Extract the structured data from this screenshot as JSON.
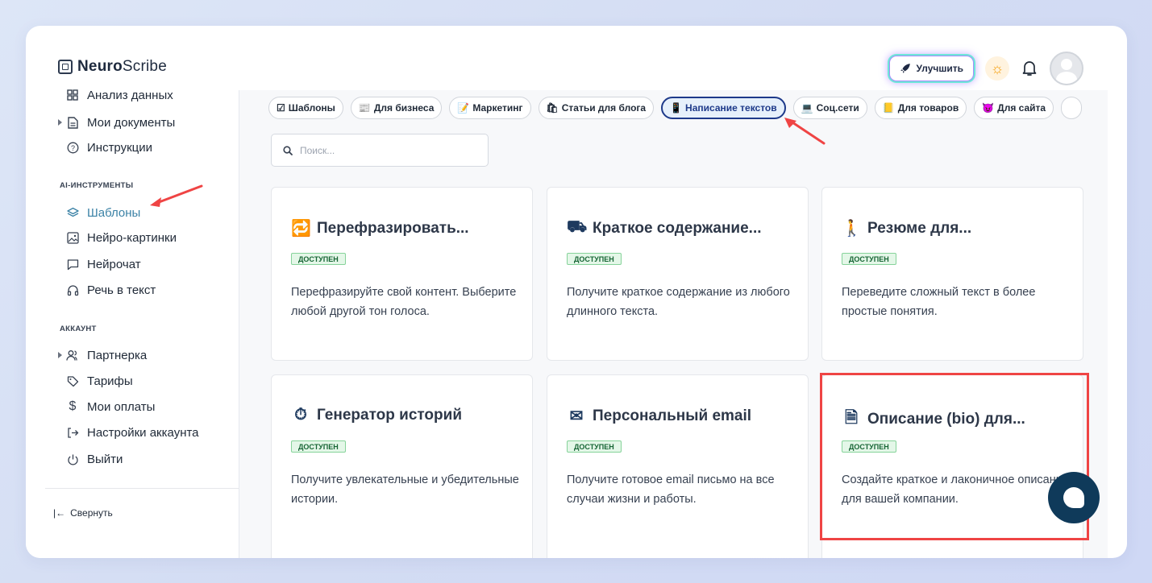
{
  "app": {
    "logo_bold": "Neuro",
    "logo_rest": "Scribe"
  },
  "header": {
    "upgrade_label": "Улучшить",
    "theme_icon": "sun-icon",
    "notifications_icon": "bell-icon",
    "avatar_icon": "user-avatar-icon"
  },
  "sidebar": {
    "top_items": [
      {
        "label": "Анализ данных",
        "icon": "grid-icon"
      },
      {
        "label": "Мои документы",
        "icon": "document-icon"
      },
      {
        "label": "Инструкции",
        "icon": "help-circle-icon"
      }
    ],
    "ai_section_title": "AI-ИНСТРУМЕНТЫ",
    "ai_items": [
      {
        "label": "Шаблоны",
        "icon": "layers-icon"
      },
      {
        "label": "Нейро-картинки",
        "icon": "image-icon"
      },
      {
        "label": "Нейрочат",
        "icon": "chat-icon"
      },
      {
        "label": "Речь в текст",
        "icon": "headphones-icon"
      }
    ],
    "account_section_title": "АККАУНТ",
    "account_items": [
      {
        "label": "Партнерка",
        "icon": "users-icon"
      },
      {
        "label": "Тарифы",
        "icon": "tag-icon"
      },
      {
        "label": "Мои оплаты",
        "icon": "dollar-icon"
      },
      {
        "label": "Настройки аккаунта",
        "icon": "logout-arrow-icon"
      },
      {
        "label": "Выйти",
        "icon": "power-icon"
      }
    ],
    "collapse_label": "Свернуть"
  },
  "categories": [
    {
      "emoji": "☑",
      "label": "Шаблоны"
    },
    {
      "emoji": "📰",
      "label": "Для бизнеса"
    },
    {
      "emoji": "📝",
      "label": "Маркетинг"
    },
    {
      "emoji": "🛍",
      "label": "Статьи для блога"
    },
    {
      "emoji": "📱",
      "label": "Написание текстов"
    },
    {
      "emoji": "💻",
      "label": "Соц.сети"
    },
    {
      "emoji": "📒",
      "label": "Для товаров"
    },
    {
      "emoji": "😈",
      "label": "Для сайта"
    }
  ],
  "active_category": "Написание текстов",
  "search": {
    "placeholder": "Поиск..."
  },
  "cards": [
    {
      "icon": "🔁",
      "title": "Перефразировать...",
      "badge": "ДОСТУПЕН",
      "desc": "Перефразируйте свой контент. Выберите любой другой тон голоса."
    },
    {
      "icon": "⛟",
      "title": "Краткое содержание...",
      "badge": "ДОСТУПЕН",
      "desc": "Получите краткое содержание из любого длинного текста."
    },
    {
      "icon": "🚶",
      "title": "Резюме для...",
      "badge": "ДОСТУПЕН",
      "desc": "Переведите сложный текст в более простые понятия."
    },
    {
      "icon": "⏱",
      "title": "Генератор историй",
      "badge": "ДОСТУПЕН",
      "desc": "Получите увлекательные и убедительные истории."
    },
    {
      "icon": "✉",
      "title": "Персональный email",
      "badge": "ДОСТУПЕН",
      "desc": "Получите готовое email письмо на все случаи жизни и работы."
    },
    {
      "icon": "🗎",
      "title": "Описание (bio) для...",
      "badge": "ДОСТУПЕН",
      "desc": "Создайте краткое и лаконичное описание для вашей компании."
    }
  ],
  "colors": {
    "accent": "#3b82a6",
    "badge_bg": "#e4f7e8",
    "highlight": "#ef4444",
    "chat": "#0f3a5a"
  }
}
